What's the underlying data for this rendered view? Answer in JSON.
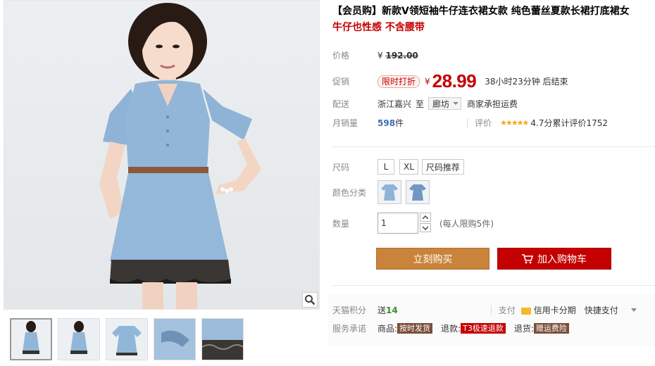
{
  "product": {
    "title_line1": "【会员购】新款V领短袖牛仔连衣裙女款 纯色蕾丝夏款长裙打底裙女",
    "title_line2": "牛仔也性感 不含腰带"
  },
  "price": {
    "label": "价格",
    "currency": "¥",
    "original": "192.00"
  },
  "promo": {
    "label": "促销",
    "tag": "限时打折",
    "currency": "¥",
    "price": "28.99",
    "countdown": "38小时23分钟 后结束"
  },
  "delivery": {
    "label": "配送",
    "from": "浙江嘉兴",
    "to_word": "至",
    "city": "廊坊",
    "fee": "商家承担运费"
  },
  "sales": {
    "label": "月销量",
    "count": "598",
    "unit": "件",
    "review_label": "评价",
    "stars": "★★★★★",
    "rating_text": "4.7分累计评价1752"
  },
  "size": {
    "label": "尺码",
    "options": [
      "L",
      "XL"
    ],
    "guide": "尺码推荐"
  },
  "color": {
    "label": "颜色分类"
  },
  "quantity": {
    "label": "数量",
    "value": "1",
    "limit_note": "(每人限购5件)"
  },
  "buttons": {
    "buy_now": "立刻购买",
    "add_to_cart": "加入购物车"
  },
  "points": {
    "label": "天猫积分",
    "send_word": "送",
    "value": "14"
  },
  "payment": {
    "label": "支付",
    "credit": "信用卡分期",
    "quick": "快捷支付"
  },
  "promise": {
    "label": "服务承诺",
    "goods_label": "商品:",
    "goods_tag": "按时发货",
    "refund_label": "退款:",
    "refund_tag": "T3极速退款",
    "return_label": "退货:",
    "return_tag": "赠运费险"
  },
  "colors": {
    "accent_red": "#c40000",
    "buy_orange": "#c9833a",
    "denim": "#8fb3d6",
    "link_blue": "#3c6cb7"
  }
}
